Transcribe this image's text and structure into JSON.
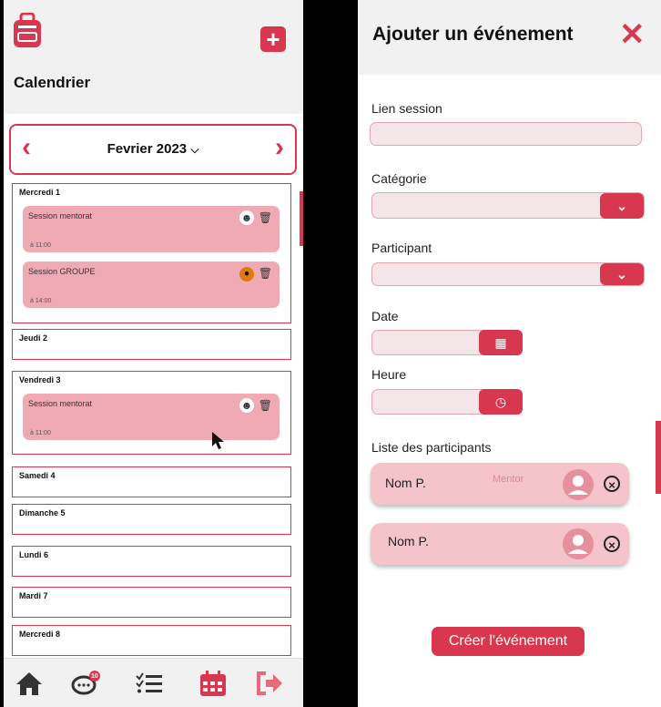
{
  "calendar": {
    "title": "Calendrier",
    "month": "Fevrier 2023",
    "days": [
      {
        "label": "Mercredi 1",
        "events": [
          {
            "title": "Session mentorat",
            "time": "à 11:00",
            "type": "person"
          },
          {
            "title": "Session GROUPE",
            "time": "à 14:00",
            "type": "group"
          }
        ]
      },
      {
        "label": "Jeudi 2",
        "events": []
      },
      {
        "label": "Vendredi 3",
        "events": [
          {
            "title": "Session mentorat",
            "time": "à 11:00",
            "type": "person"
          }
        ]
      },
      {
        "label": "Samedi 4",
        "events": []
      },
      {
        "label": "Dimanche 5",
        "events": []
      },
      {
        "label": "Lundi 6",
        "events": []
      },
      {
        "label": "Mardi 7",
        "events": []
      },
      {
        "label": "Mercredi 8",
        "events": []
      }
    ],
    "nav": {
      "messages_badge": "10"
    }
  },
  "form": {
    "title": "Ajouter un événement",
    "fields": {
      "session_link": {
        "label": "Lien session",
        "value": ""
      },
      "category": {
        "label": "Catégorie",
        "value": ""
      },
      "participant": {
        "label": "Participant",
        "value": ""
      },
      "date": {
        "label": "Date",
        "value": ""
      },
      "time": {
        "label": "Heure",
        "value": ""
      }
    },
    "participants_label": "Liste des participants",
    "participants": [
      {
        "name": "Nom P.",
        "role": "Mentor"
      },
      {
        "name": "Nom P.",
        "role": ""
      }
    ],
    "submit_label": "Créer l'événement"
  },
  "colors": {
    "accent": "#d93650",
    "event_bg": "#f0aab4",
    "participant_bg": "#f4c4ca"
  }
}
